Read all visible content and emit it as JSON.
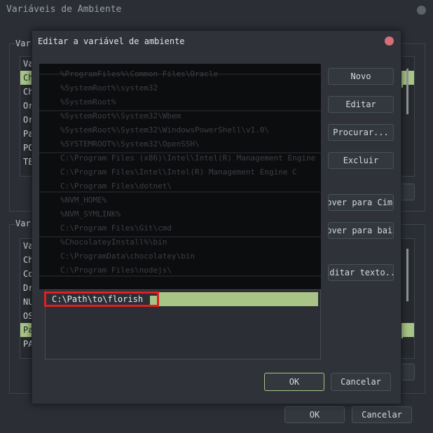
{
  "outer_window": {
    "title": "Variáveis de Ambiente",
    "user_group_label": "Var",
    "system_group_label": "Var",
    "user_list": [
      "Va",
      "Ch",
      "Ch",
      "Or",
      "Or",
      "Pa",
      "PO",
      "TE"
    ],
    "system_list": [
      "Va",
      "Ch",
      "Co",
      "Dr",
      "NU",
      "OS",
      "Pa",
      "PA"
    ],
    "ok_label": "OK",
    "cancel_label": "Cancelar"
  },
  "dialog": {
    "title": "Editar a variável de ambiente",
    "buttons": {
      "new": "Novo",
      "edit": "Editar",
      "browse": "Procurar...",
      "delete": "Excluir",
      "move_up": "Mover para Cima",
      "move_down": "Mover para baixo",
      "edit_text": "Editar texto..."
    },
    "path_entries": [
      "%ProgramFiles%\\Common Files\\Oracle",
      "%SystemRoot%\\system32",
      "%SystemRoot%",
      "%SystemRoot%\\System32\\Wbem",
      "%SystemRoot%\\System32\\WindowsPowerShell\\v1.0\\",
      "%SYSTEMROOT%\\System32\\OpenSSH\\",
      "C:\\Program Files (x86)\\Intel\\Intel(R) Management Engine",
      "C:\\Program Files\\Intel\\Intel(R) Management Engine C",
      "C:\\Program Files\\dotnet\\",
      "%NVM_HOME%",
      "%NVM_SYMLINK%",
      "C:\\Program Files\\Git\\cmd",
      "%ChocolateyInstall%\\bin",
      "C:\\ProgramData\\chocolatey\\bin",
      "C:\\Program Files\\nodejs\\"
    ],
    "editing_value": "C:\\Path\\to\\florish",
    "ok_label": "OK",
    "cancel_label": "Cancelar"
  },
  "colors": {
    "accent": "#a8c486",
    "highlight_box": "#e02020",
    "close_dot": "#d5707a"
  }
}
